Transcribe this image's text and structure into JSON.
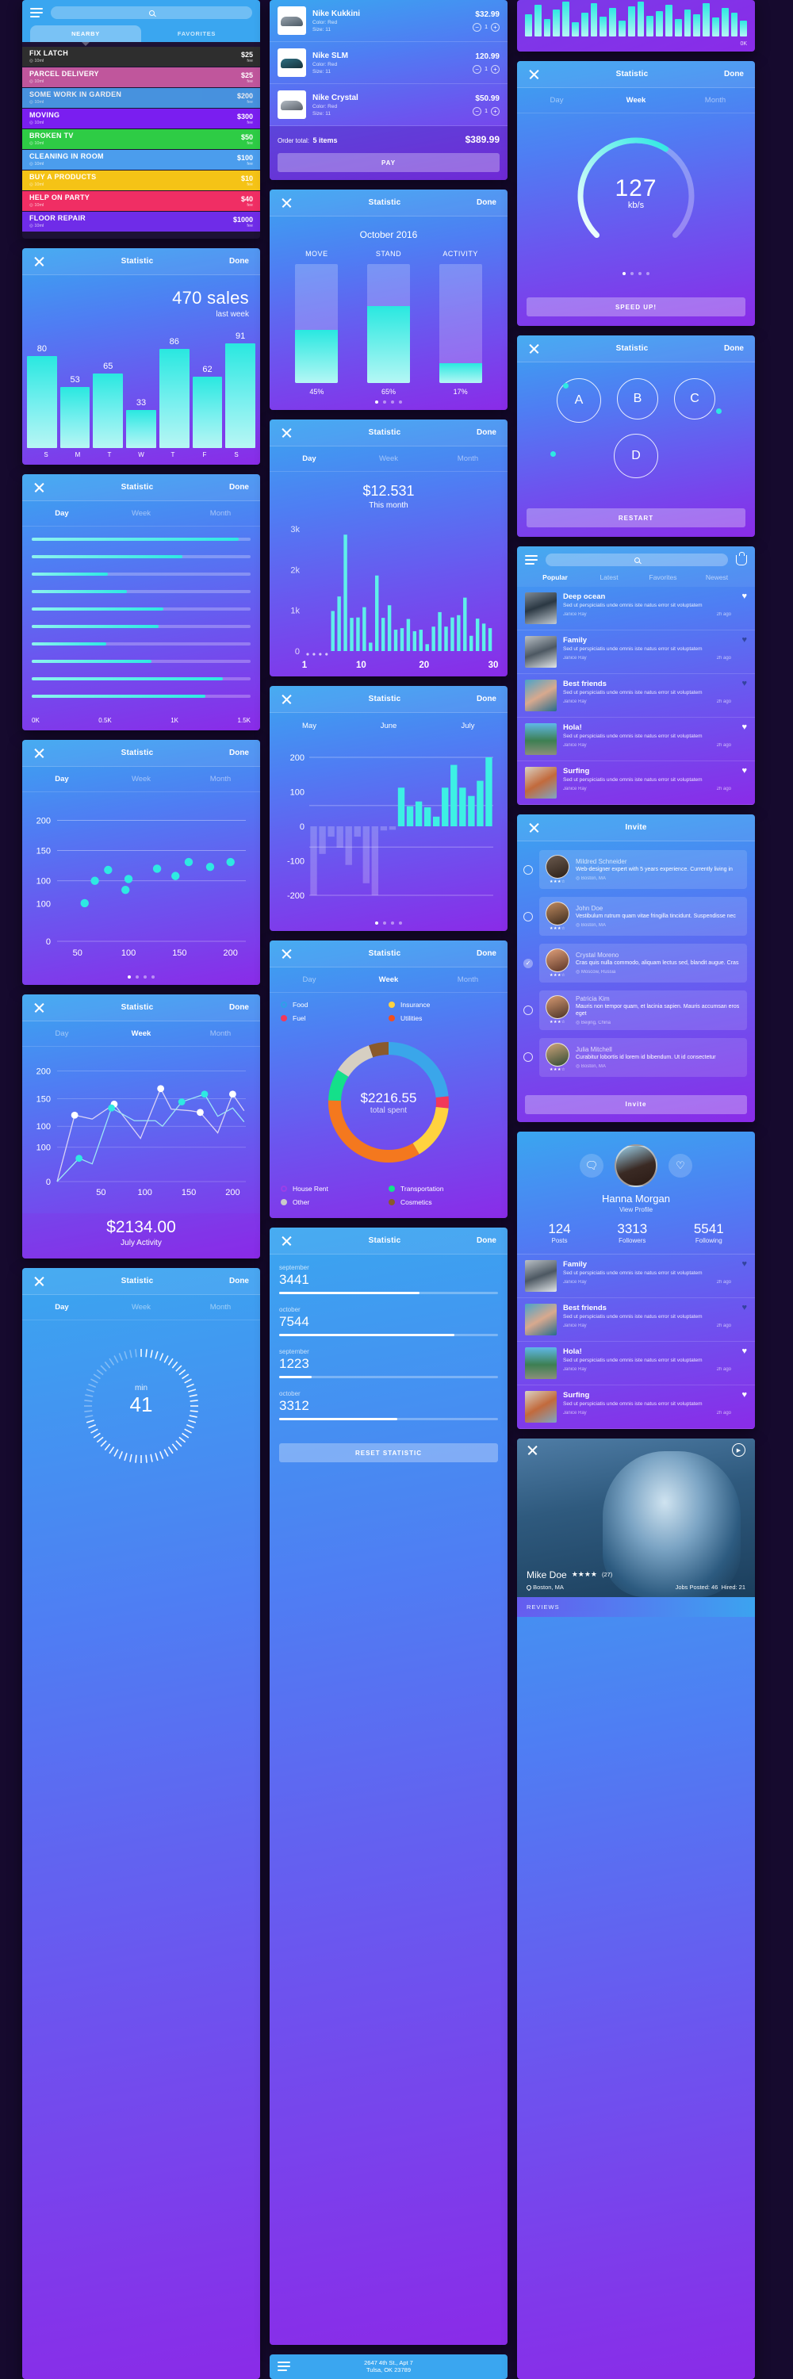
{
  "common": {
    "close_icon": "close-icon",
    "title": "Statistic",
    "done": "Done",
    "tabs": {
      "day": "Day",
      "week": "Week",
      "month": "Month"
    }
  },
  "tasks_card": {
    "search_placeholder": "",
    "tabs": [
      {
        "label": "NEARBY",
        "active": true
      },
      {
        "label": "FAVORITES",
        "active": false
      }
    ],
    "items": [
      {
        "name": "FIX LATCH",
        "dist": "10ml",
        "price": "$25",
        "unit": "fee",
        "color": "#2e2e2e",
        "muted": false
      },
      {
        "name": "PARCEL DELIVERY",
        "dist": "10ml",
        "price": "$25",
        "unit": "fee",
        "color": "#c0569c",
        "muted": false
      },
      {
        "name": "SOME WORK IN GARDEN",
        "dist": "10ml",
        "price": "$200",
        "unit": "fee",
        "color": "#4b9ded",
        "muted": true
      },
      {
        "name": "MOVING",
        "dist": "10ml",
        "price": "$300",
        "unit": "fee",
        "color": "#7a1ef0",
        "muted": false
      },
      {
        "name": "BROKEN TV",
        "dist": "10ml",
        "price": "$50",
        "unit": "fee",
        "color": "#2ecc45",
        "muted": false
      },
      {
        "name": "CLEANING IN ROOM",
        "dist": "10ml",
        "price": "$100",
        "unit": "fee",
        "color": "#4b9ded",
        "muted": false
      },
      {
        "name": "BUY A PRODUCTS",
        "dist": "10ml",
        "price": "$10",
        "unit": "fee",
        "color": "#f5c316",
        "muted": false
      },
      {
        "name": "HELP ON PARTY",
        "dist": "10ml",
        "price": "$40",
        "unit": "fee",
        "color": "#f02e64",
        "muted": false
      },
      {
        "name": "FLOOR REPAIR",
        "dist": "10ml",
        "price": "$1000",
        "unit": "fee",
        "color": "#6f2ce8",
        "muted": false
      }
    ]
  },
  "cart_card": {
    "items": [
      {
        "name": "Nike Kukkini",
        "color_label": "Color: Red",
        "size_label": "Size: 11",
        "price": "$32.99",
        "qty": "1"
      },
      {
        "name": "Nike SLM",
        "color_label": "Color: Red",
        "size_label": "Size: 11",
        "price": "120.99",
        "qty": "1"
      },
      {
        "name": "Nike Crystal",
        "color_label": "Color: Red",
        "size_label": "Size: 11",
        "price": "$50.99",
        "qty": "1"
      }
    ],
    "order_total_label": "Order total:",
    "order_total_items": "5 items",
    "order_total_amount": "$389.99",
    "pay_button": "PAY"
  },
  "sales_card": {
    "headline": "470 sales",
    "sub": "last week",
    "chart_data": {
      "type": "bar",
      "title": "470 sales last week",
      "categories": [
        "S",
        "M",
        "T",
        "W",
        "T",
        "F",
        "S"
      ],
      "values": [
        80,
        53,
        65,
        33,
        86,
        62,
        91
      ],
      "ylim": [
        0,
        100
      ],
      "xlabel": "",
      "ylabel": "",
      "grid": false,
      "legend": "none"
    }
  },
  "hbar_card": {
    "active_tab": "Day",
    "axis": [
      "0K",
      "0.5K",
      "1K",
      "1.5K"
    ],
    "chart_data": {
      "type": "bar",
      "orientation": "horizontal",
      "categories": [
        "1",
        "2",
        "3",
        "4",
        "5",
        "6",
        "7",
        "8",
        "9",
        "10"
      ],
      "values": [
        1.42,
        1.03,
        0.52,
        0.65,
        0.9,
        0.87,
        0.51,
        0.82,
        1.31,
        1.19
      ],
      "xlim": [
        0,
        1.5
      ],
      "xlabel": "",
      "ylabel": "",
      "grid": false
    }
  },
  "scatter_card": {
    "active_tab": "Day",
    "chart_data": {
      "type": "scatter",
      "x": [
        57,
        67,
        80,
        97,
        100,
        128,
        146,
        159,
        180,
        200
      ],
      "y": [
        63,
        100,
        118,
        85,
        103,
        120,
        108,
        131,
        123,
        131
      ],
      "xticks": [
        50,
        100,
        150,
        200
      ],
      "yticks": [
        0,
        100,
        100,
        150,
        200
      ],
      "xlim": [
        30,
        215
      ],
      "ylim": [
        0,
        215
      ],
      "xlabel": "",
      "ylabel": "",
      "grid": true
    }
  },
  "line_card": {
    "active_tab": "Week",
    "footer_value": "$2134.00",
    "footer_label": "July Activity",
    "chart_data": {
      "type": "line",
      "xticks": [
        50,
        100,
        150,
        200
      ],
      "yticks": [
        0,
        100,
        100,
        150,
        200
      ],
      "xlim": [
        0,
        215
      ],
      "ylim": [
        0,
        215
      ],
      "series": [
        {
          "name": "series-a",
          "color": "#d8d2f5",
          "x": [
            0,
            20,
            40,
            65,
            95,
            118,
            130,
            152,
            163,
            183,
            200,
            213
          ],
          "y": [
            0,
            120,
            113,
            140,
            78,
            168,
            131,
            128,
            125,
            88,
            158,
            128
          ]
        },
        {
          "name": "series-b",
          "color": "#9fe6f5",
          "x": [
            0,
            25,
            40,
            62,
            88,
            112,
            120,
            142,
            168,
            183,
            200,
            213
          ],
          "y": [
            0,
            42,
            32,
            133,
            110,
            110,
            100,
            144,
            158,
            118,
            133,
            108
          ]
        }
      ],
      "markers": [
        {
          "x": 20,
          "y": 120,
          "color": "#ffffff"
        },
        {
          "x": 65,
          "y": 140,
          "color": "#ffffff"
        },
        {
          "x": 118,
          "y": 168,
          "color": "#ffffff"
        },
        {
          "x": 163,
          "y": 125,
          "color": "#ffffff"
        },
        {
          "x": 200,
          "y": 158,
          "color": "#ffffff"
        },
        {
          "x": 25,
          "y": 42,
          "color": "#2ee9e2"
        },
        {
          "x": 62,
          "y": 133,
          "color": "#2ee9e2"
        },
        {
          "x": 142,
          "y": 144,
          "color": "#2ee9e2"
        },
        {
          "x": 168,
          "y": 158,
          "color": "#2ee9e2"
        }
      ]
    }
  },
  "ring_card": {
    "active_tab": "Day",
    "value": "41",
    "unit_label": "min"
  },
  "activity_card": {
    "month": "October 2016",
    "chart_data": {
      "type": "bar",
      "title": "October 2016",
      "categories": [
        "MOVE",
        "STAND",
        "ACTIVITY"
      ],
      "values": [
        45,
        65,
        17
      ],
      "value_labels": [
        "45%",
        "65%",
        "17%"
      ],
      "ylim": [
        0,
        100
      ],
      "ylabel": "",
      "xlabel": ""
    },
    "dots": 4,
    "active_dot": 0
  },
  "hist_card": {
    "active_tab": "Day",
    "value": "$12.531",
    "sub": "This month",
    "chart_data": {
      "type": "bar",
      "title": "$12.531 This month",
      "categories": [
        1,
        2,
        3,
        4,
        5,
        6,
        7,
        8,
        9,
        10,
        11,
        12,
        13,
        14,
        15,
        16,
        17,
        18,
        19,
        20,
        21,
        22,
        23,
        24,
        25,
        26,
        27,
        28,
        29,
        30
      ],
      "values": [
        0,
        0,
        0,
        0,
        1050,
        1430,
        3050,
        870,
        880,
        1150,
        220,
        1980,
        870,
        1200,
        560,
        600,
        840,
        520,
        560,
        180,
        640,
        1020,
        640,
        880,
        940,
        1400,
        400,
        850,
        720,
        600
      ],
      "yticks": [
        "0",
        "1k",
        "2k",
        "3k"
      ],
      "xticks": [
        "1",
        "10",
        "20",
        "30"
      ],
      "ylim": [
        0,
        3200
      ]
    }
  },
  "months_card": {
    "labels": [
      "May",
      "June",
      "July"
    ],
    "chart_data": {
      "type": "bar",
      "categories": [
        "May",
        "",
        "",
        "",
        "",
        "",
        "",
        "",
        "June",
        "",
        "",
        "",
        "",
        "",
        "",
        "July",
        "",
        "",
        ""
      ],
      "values": [
        -200,
        -80,
        -30,
        -62,
        -112,
        -30,
        -165,
        -200,
        -12,
        -10,
        112,
        58,
        72,
        55,
        28,
        112,
        178,
        112,
        88,
        132,
        200
      ],
      "yticks": [
        -200,
        -100,
        0,
        100,
        200
      ],
      "ylim": [
        -200,
        200
      ],
      "grid": true
    },
    "dots": 4,
    "active_dot": 0
  },
  "donut_card": {
    "active_tab": "Week",
    "center_value": "$2216.55",
    "center_label": "total spent",
    "legend_top": [
      {
        "label": "Food",
        "color": "#2f9fe8",
        "hollow": true
      },
      {
        "label": "Insurance",
        "color": "#ffd23f",
        "hollow": false
      },
      {
        "label": "Fuel",
        "color": "#f2385a",
        "hollow": false
      },
      {
        "label": "Utilities",
        "color": "#f24e1e",
        "hollow": false
      }
    ],
    "legend_bottom": [
      {
        "label": "House Rent",
        "color": "#9b3fe8",
        "hollow": true
      },
      {
        "label": "Transportation",
        "color": "#14e08a",
        "hollow": false
      },
      {
        "label": "Other",
        "color": "#c9c9c9",
        "hollow": false
      },
      {
        "label": "Cosmetics",
        "color": "#8a5a2b",
        "hollow": false
      }
    ],
    "chart_data": {
      "type": "pie",
      "title": "$2216.55 total spent",
      "labels": [
        "Food",
        "Fuel",
        "Insurance",
        "House Rent",
        "Transportation",
        "Other",
        "Cosmetics"
      ],
      "values": [
        22,
        3,
        14,
        32,
        8,
        10,
        5
      ],
      "colors": [
        "#3aa6ea",
        "#f2385a",
        "#ffd23f",
        "#f4781e",
        "#14e08a",
        "#d6cfc2",
        "#8a5a2b"
      ],
      "donut": true
    }
  },
  "progress_card": {
    "items": [
      {
        "label": "september",
        "value": "3441",
        "pct": 64
      },
      {
        "label": "october",
        "value": "7544",
        "pct": 80
      },
      {
        "label": "september",
        "value": "1223",
        "pct": 15
      },
      {
        "label": "october",
        "value": "3312",
        "pct": 54
      }
    ],
    "reset_button": "RESET STATISTIC"
  },
  "visualizer_card": {
    "ok_label": "0K",
    "bars": [
      28,
      40,
      22,
      34,
      44,
      18,
      30,
      42,
      25,
      36,
      20,
      38,
      44,
      26,
      32,
      40,
      22,
      34,
      28,
      42,
      24,
      36,
      30,
      20
    ]
  },
  "gauge_card": {
    "active_tab": "Week",
    "value": "127",
    "unit": "kb/s",
    "button": "SPEED UP!",
    "chart_data": {
      "type": "gauge",
      "value": 127,
      "max": 200,
      "unit": "kb/s",
      "pct": 62
    },
    "dots": 4,
    "active_dot": 0
  },
  "abcd_card": {
    "nodes": [
      "A",
      "B",
      "C",
      "D"
    ],
    "button": "RESTART"
  },
  "feed_card": {
    "tabs": [
      {
        "label": "Popular",
        "active": true
      },
      {
        "label": "Latest",
        "active": false
      },
      {
        "label": "Favorites",
        "active": false
      },
      {
        "label": "Newest",
        "active": false
      }
    ],
    "items": [
      {
        "title": "Deep ocean",
        "desc": "Sed ut perspiciatis unde omnis iste natus error sit voluptatem",
        "author": "Janice Ray",
        "time": "2h ago",
        "liked": true,
        "thumb": "t1"
      },
      {
        "title": "Family",
        "desc": "Sed ut perspiciatis unde omnis iste natus error sit voluptatem",
        "author": "Janice Ray",
        "time": "2h ago",
        "liked": false,
        "thumb": "t2"
      },
      {
        "title": "Best friends",
        "desc": "Sed ut perspiciatis unde omnis iste natus error sit voluptatem",
        "author": "Janice Ray",
        "time": "2h ago",
        "liked": false,
        "thumb": "t3"
      },
      {
        "title": "Hola!",
        "desc": "Sed ut perspiciatis unde omnis iste natus error sit voluptatem",
        "author": "Janice Ray",
        "time": "2h ago",
        "liked": true,
        "thumb": "t4"
      },
      {
        "title": "Surfing",
        "desc": "Sed ut perspiciatis unde omnis iste natus error sit voluptatem",
        "author": "Janice Ray",
        "time": "2h ago",
        "liked": true,
        "thumb": "t5"
      }
    ]
  },
  "invite_card": {
    "title": "Invite",
    "button": "Invite",
    "people": [
      {
        "name": "Mildred Schneider",
        "desc": "Web-designer expert with 5 years experience. Currently living in",
        "loc": "Boston, MA",
        "selected": false,
        "stars": "★★★☆"
      },
      {
        "name": "John Doe",
        "desc": "Vestibulum rutrum quam vitae fringilla tincidunt. Suspendisse nec",
        "loc": "Boston, MA",
        "selected": false,
        "stars": "★★★☆"
      },
      {
        "name": "Crystal Moreno",
        "desc": "Cras quis nulla commodo, aliquam lectus sed, blandit augue. Cras",
        "loc": "Moscow, Russia",
        "selected": true,
        "stars": "★★★☆"
      },
      {
        "name": "Patricia Kim",
        "desc": "Mauris non tempor quam, et lacinia sapien. Mauris accumsan eros eget",
        "loc": "Beijing, China",
        "selected": false,
        "stars": "★★★☆"
      },
      {
        "name": "Julia Mitchell",
        "desc": "Curabitur lobortis id lorem id bibendum. Ut id consectetur",
        "loc": "Boston, MA",
        "selected": false,
        "stars": "★★★☆"
      }
    ]
  },
  "profile_card": {
    "name": "Hanna Morgan",
    "view_profile": "View Profile",
    "stats": [
      {
        "value": "124",
        "label": "Posts"
      },
      {
        "value": "3313",
        "label": "Followers"
      },
      {
        "value": "5541",
        "label": "Following"
      }
    ],
    "items": [
      {
        "title": "Family",
        "desc": "Sed ut perspiciatis unde omnis iste natus error sit voluptatem",
        "author": "Janice Ray",
        "time": "2h ago",
        "liked": false,
        "thumb": "t2"
      },
      {
        "title": "Best friends",
        "desc": "Sed ut perspiciatis unde omnis iste natus error sit voluptatem",
        "author": "Janice Ray",
        "time": "2h ago",
        "liked": false,
        "thumb": "t3"
      },
      {
        "title": "Hola!",
        "desc": "Sed ut perspiciatis unde omnis iste natus error sit voluptatem",
        "author": "Janice Ray",
        "time": "2h ago",
        "liked": true,
        "thumb": "t4"
      },
      {
        "title": "Surfing",
        "desc": "Sed ut perspiciatis unde omnis iste natus error sit voluptatem",
        "author": "Janice Ray",
        "time": "2h ago",
        "liked": true,
        "thumb": "t5"
      }
    ]
  },
  "mike_card": {
    "name": "Mike Doe",
    "stars": "★★★★",
    "rating_count": "(27)",
    "location": "Boston, MA",
    "jobs_posted": "Jobs Posted: 46",
    "hired": "Hired: 21",
    "reviews_label": "REVIEWS"
  },
  "address_card": {
    "line1": "2647 4th St., Apt 7",
    "line2": "Tulsa, OK 23789"
  }
}
